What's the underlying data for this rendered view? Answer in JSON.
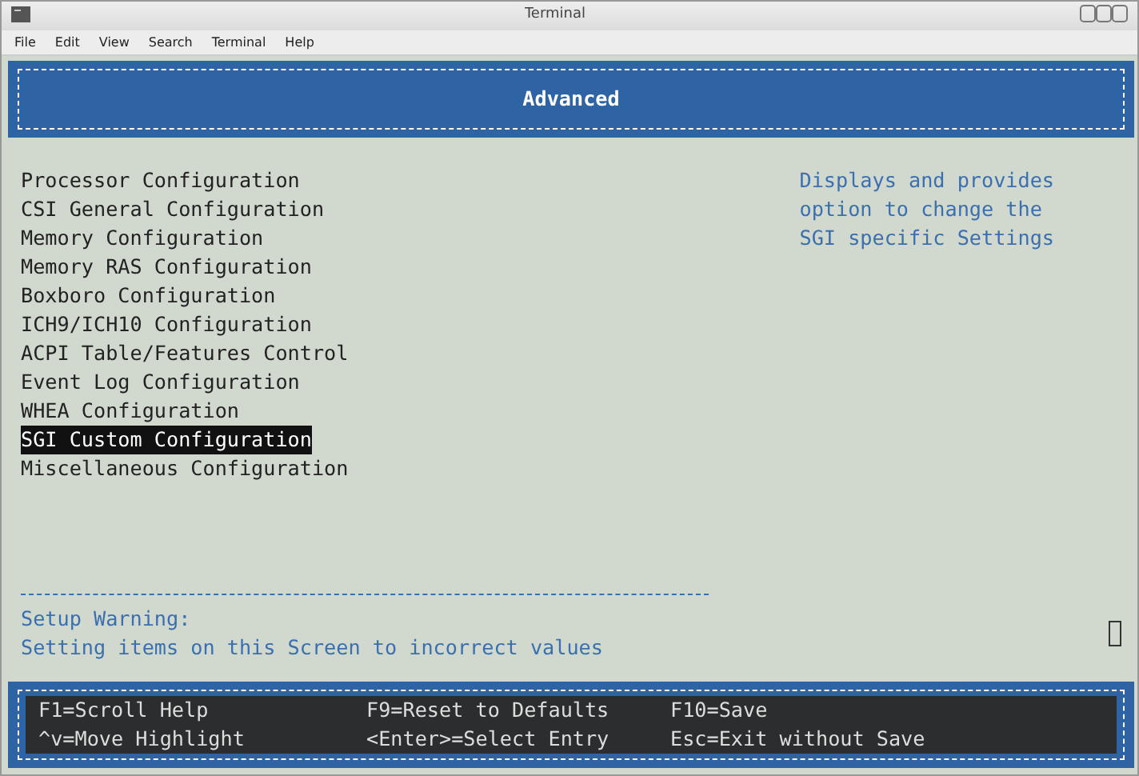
{
  "window": {
    "title": "Terminal"
  },
  "menu": [
    "File",
    "Edit",
    "View",
    "Search",
    "Terminal",
    "Help"
  ],
  "header": {
    "title": "Advanced"
  },
  "items": [
    {
      "label": "Processor Configuration",
      "selected": false
    },
    {
      "label": "CSI General Configuration",
      "selected": false
    },
    {
      "label": "Memory Configuration",
      "selected": false
    },
    {
      "label": "Memory RAS Configuration",
      "selected": false
    },
    {
      "label": "Boxboro Configuration",
      "selected": false
    },
    {
      "label": "ICH9/ICH10 Configuration",
      "selected": false
    },
    {
      "label": "ACPI Table/Features Control",
      "selected": false
    },
    {
      "label": "Event Log Configuration",
      "selected": false
    },
    {
      "label": "WHEA Configuration",
      "selected": false
    },
    {
      "label": "SGI Custom Configuration",
      "selected": true
    },
    {
      "label": "Miscellaneous Configuration",
      "selected": false
    }
  ],
  "help_text": [
    "Displays and provides",
    "option to change the",
    "SGI specific Settings"
  ],
  "warning": [
    "Setup Warning:",
    "Setting items on this Screen to incorrect values"
  ],
  "keys": [
    [
      "F1=Scroll Help",
      "F9=Reset to Defaults",
      "F10=Save"
    ],
    [
      "^v=Move Highlight",
      "<Enter>=Select Entry",
      "Esc=Exit without Save"
    ]
  ]
}
